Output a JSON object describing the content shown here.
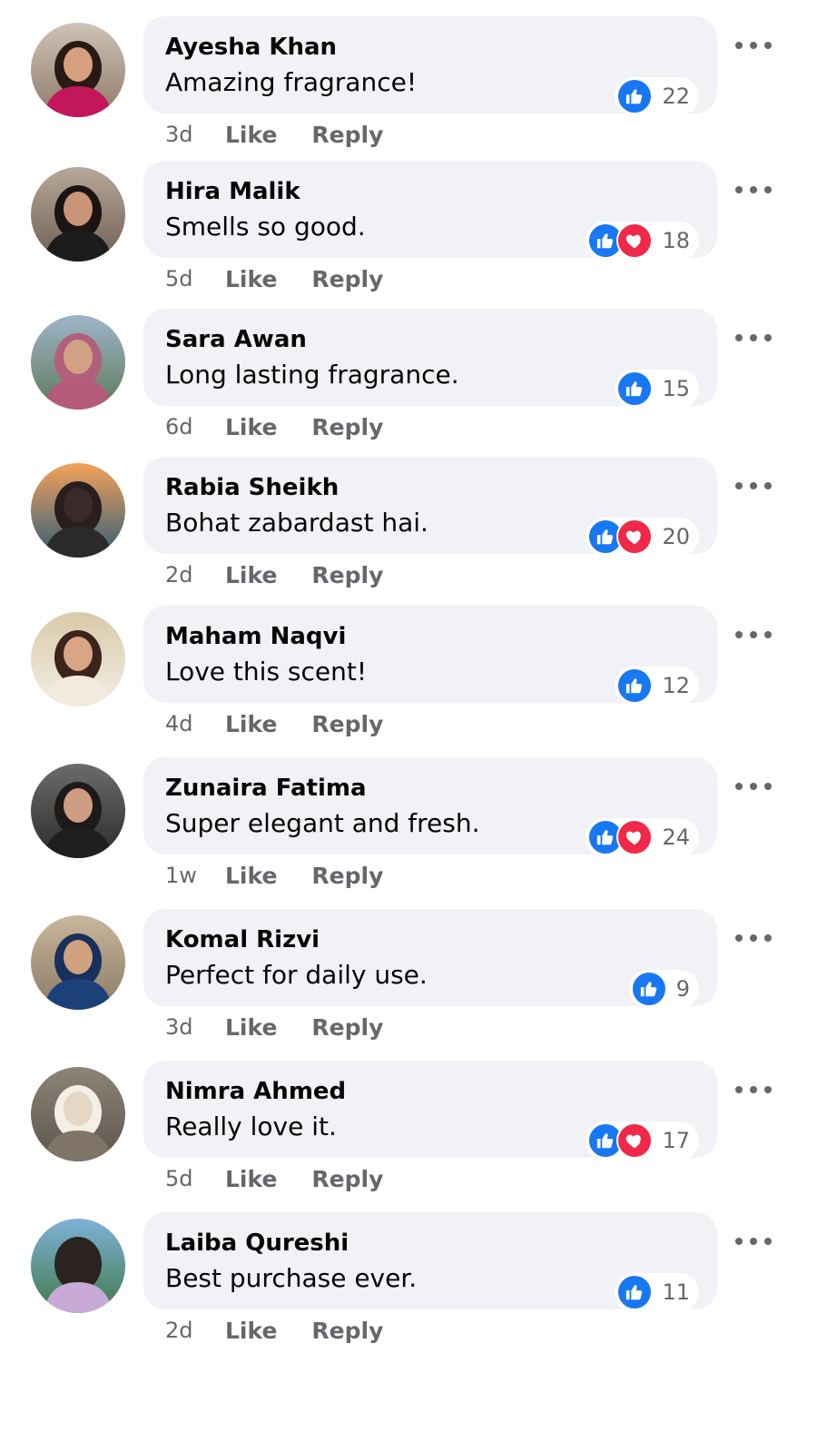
{
  "actions": {
    "like_label": "Like",
    "reply_label": "Reply"
  },
  "colors": {
    "like": "#1877f2",
    "love": "#f02849",
    "bubble": "#f0f2f5",
    "meta": "#65676b"
  },
  "comments": [
    {
      "author": "Ayesha Khan",
      "text": "Amazing fragrance!",
      "time": "3d",
      "count": "22",
      "reactions": [
        "like"
      ]
    },
    {
      "author": "Hira Malik",
      "text": "Smells so good.",
      "time": "5d",
      "count": "18",
      "reactions": [
        "like",
        "love"
      ]
    },
    {
      "author": "Sara Awan",
      "text": "Long lasting fragrance.",
      "time": "6d",
      "count": "15",
      "reactions": [
        "like"
      ]
    },
    {
      "author": "Rabia Sheikh",
      "text": "Bohat zabardast hai.",
      "time": "2d",
      "count": "20",
      "reactions": [
        "like",
        "love"
      ]
    },
    {
      "author": "Maham Naqvi",
      "text": "Love this scent!",
      "time": "4d",
      "count": "12",
      "reactions": [
        "like"
      ]
    },
    {
      "author": "Zunaira Fatima",
      "text": "Super elegant and fresh.",
      "time": "1w",
      "count": "24",
      "reactions": [
        "like",
        "love"
      ]
    },
    {
      "author": "Komal Rizvi",
      "text": "Perfect for daily use.",
      "time": "3d",
      "count": "9",
      "reactions": [
        "like"
      ]
    },
    {
      "author": "Nimra Ahmed",
      "text": "Really love it.",
      "time": "5d",
      "count": "17",
      "reactions": [
        "like",
        "love"
      ]
    },
    {
      "author": "Laiba Qureshi",
      "text": "Best purchase ever.",
      "time": "2d",
      "count": "11",
      "reactions": [
        "like"
      ]
    }
  ]
}
